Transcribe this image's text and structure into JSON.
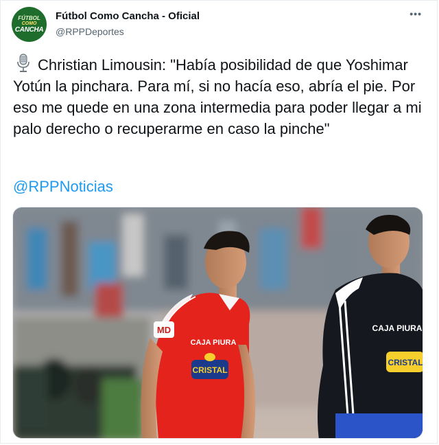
{
  "tweet": {
    "author_name": "Fútbol Como Cancha - Oficial",
    "author_handle": "@RPPDeportes",
    "avatar": {
      "line1": "FÚTBOL",
      "line2": "COMO",
      "line3": "CANCHA"
    },
    "more_label": "•••",
    "body": "Christian Limousin: \"Había posibilidad de que Yoshimar Yotún la pinchara. Para mí, si no hacía eso, abría el pie. Por eso me quede en una zona intermedia para poder llegar a mi palo derecho o recuperarme en caso la pinche\"",
    "mention": "@RPPNoticias",
    "icons": {
      "body_icon": "microphone-icon",
      "menu_icon": "more-icon"
    }
  },
  "photo": {
    "left_jersey": {
      "sponsor": "CAJA PIURA",
      "brand": "CRISTAL",
      "number_mark": "MD"
    },
    "right_jersey": {
      "sponsor": "CAJA PIURA",
      "brand": "CRISTAL"
    }
  },
  "colors": {
    "link": "#1d9bf0",
    "handle": "#536471",
    "avatar_green": "#1f6d2c",
    "jersey_red": "#e5231d",
    "jersey_dark": "#15191f"
  }
}
